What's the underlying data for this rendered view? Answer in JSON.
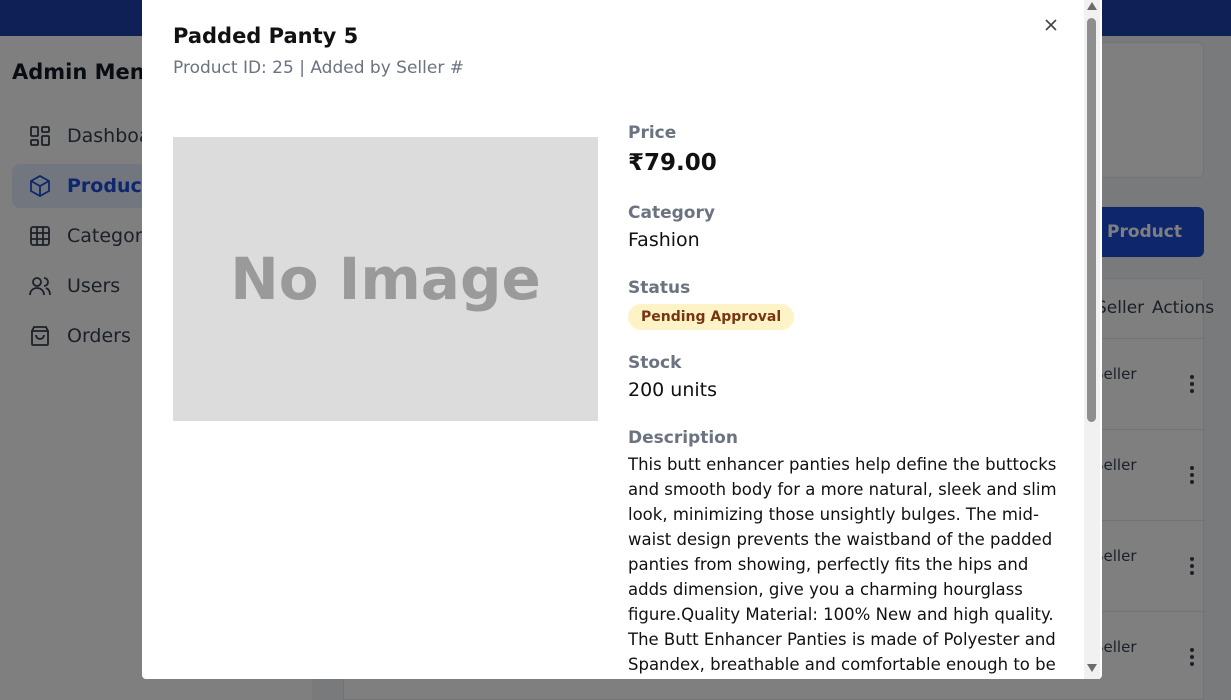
{
  "background": {
    "sidebar": {
      "title": "Admin Menu",
      "items": [
        {
          "label": "Dashboard",
          "icon": "dashboard-icon",
          "active": false
        },
        {
          "label": "Products",
          "icon": "cube-icon",
          "active": true
        },
        {
          "label": "Categories",
          "icon": "grid-icon",
          "active": false
        },
        {
          "label": "Users",
          "icon": "users-icon",
          "active": false
        },
        {
          "label": "Orders",
          "icon": "shopping-bag-icon",
          "active": false
        }
      ]
    },
    "add_product_label": "Add Product",
    "table": {
      "headers": [
        "Seller",
        "Actions"
      ],
      "row_cells": [
        "Seller",
        "Seller",
        "Seller",
        "Seller"
      ]
    }
  },
  "modal": {
    "title": "Padded Panty 5",
    "subtitle": "Product ID: 25 | Added by Seller #",
    "image_placeholder": "No Image",
    "price_label": "Price",
    "price_value": "₹79.00",
    "category_label": "Category",
    "category_value": "Fashion",
    "status_label": "Status",
    "status_value": "Pending Approval",
    "stock_label": "Stock",
    "stock_value": "200 units",
    "description_label": "Description",
    "description_value": "This butt enhancer panties help define the buttocks and smooth body for a more natural, sleek and slim look, minimizing those unsightly bulges. The mid-waist design prevents the waistband of the padded panties from showing, perfectly fits the hips and adds dimension, give you a charming hourglass figure.Quality Material: 100% New and high quality. The Butt Enhancer Panties is made of Polyester and Spandex, breathable and comfortable enough to be",
    "close_icon": "close-icon"
  },
  "colors": {
    "topbar": "#1e40af",
    "primary": "#1d4ed8",
    "badge_bg": "#fef3c7",
    "badge_text": "#78350f"
  }
}
